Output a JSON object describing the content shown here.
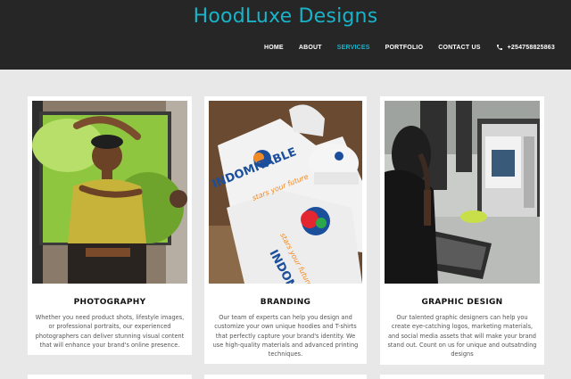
{
  "site": {
    "brand": "HoodLuxe Designs"
  },
  "nav": {
    "items": [
      "HOME",
      "ABOUT",
      "SERVICES",
      "PORTFOLIO",
      "CONTACT US"
    ],
    "active": "SERVICES",
    "phone": "+254758825863",
    "phone_icon": "phone-icon"
  },
  "colors": {
    "accent": "#19b3c9",
    "header_bg": "#262626",
    "page_bg": "#e8e8e8"
  },
  "services": [
    {
      "title": "PHOTOGRAPHY",
      "description": "Whether you need product shots, lifestyle images, or professional portraits, our experienced photographers can deliver stunning visual content that will enhance your brand's online presence."
    },
    {
      "title": "BRANDING",
      "description": "Our team of experts can help you design and customize your own unique hoodies and T-shirts that perfectly capture your brand's identity. We use high-quality materials and advanced printing techniques."
    },
    {
      "title": "GRAPHIC DESIGN",
      "description": "Our talented graphic designers can help you create eye-catching logos, marketing materials, and social media assets that will make your brand stand out. Count on us for unique and outsatnding designs"
    }
  ],
  "photo_text": {
    "word": "INDOMITABLE",
    "tagline": "stars your future"
  }
}
